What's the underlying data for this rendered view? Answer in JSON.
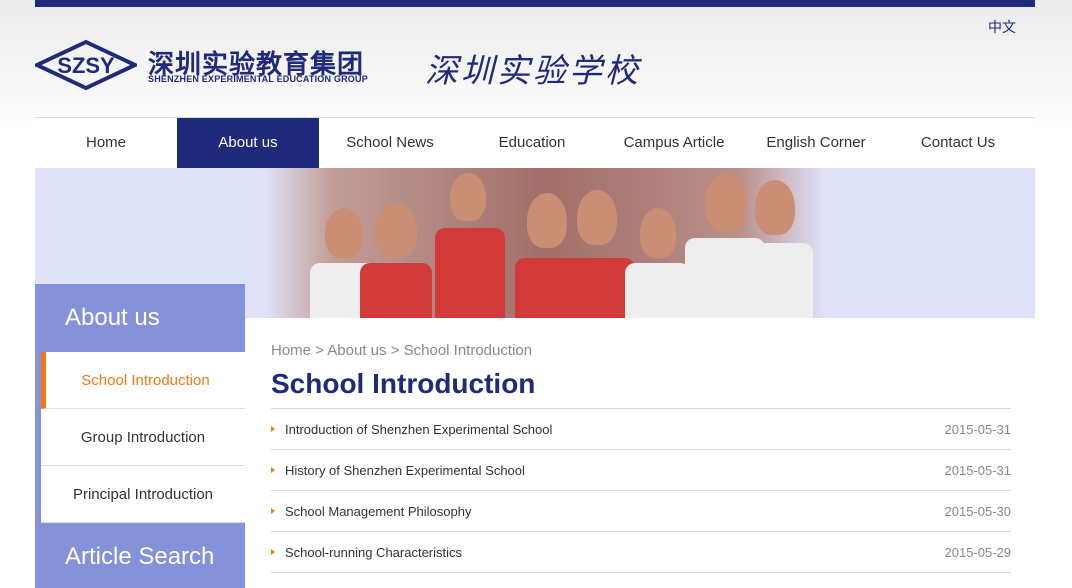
{
  "header": {
    "lang_switch": "中文",
    "logo_emblem_text": "SZSY",
    "logo_cn": "深圳实验教育集团",
    "logo_en": "SHENZHEN EXPERIMENTAL EDUCATION GROUP",
    "school_calligraphy": "深圳实验学校"
  },
  "nav": {
    "items": [
      {
        "label": "Home"
      },
      {
        "label": "About us"
      },
      {
        "label": "School News"
      },
      {
        "label": "Education"
      },
      {
        "label": "Campus Article"
      },
      {
        "label": "English Corner"
      },
      {
        "label": "Contact Us"
      }
    ],
    "active": "About us"
  },
  "sidebar": {
    "title": "About us",
    "items": [
      {
        "label": "School Introduction"
      },
      {
        "label": "Group Introduction"
      },
      {
        "label": "Principal Introduction"
      }
    ],
    "search_title": "Article Search"
  },
  "main": {
    "breadcrumb": [
      "Home",
      "About us",
      "School Introduction"
    ],
    "breadcrumb_sep": ">",
    "title": "School Introduction",
    "articles": [
      {
        "title": "Introduction of Shenzhen Experimental School",
        "date": "2015-05-31"
      },
      {
        "title": "History of Shenzhen Experimental School",
        "date": "2015-05-31"
      },
      {
        "title": "School Management Philosophy",
        "date": "2015-05-30"
      },
      {
        "title": "School-running Characteristics",
        "date": "2015-05-29"
      }
    ]
  },
  "colors": {
    "brand_navy": "#1f2a7a",
    "sidebar_purple": "#8591d8",
    "accent_orange": "#f07a1a"
  }
}
